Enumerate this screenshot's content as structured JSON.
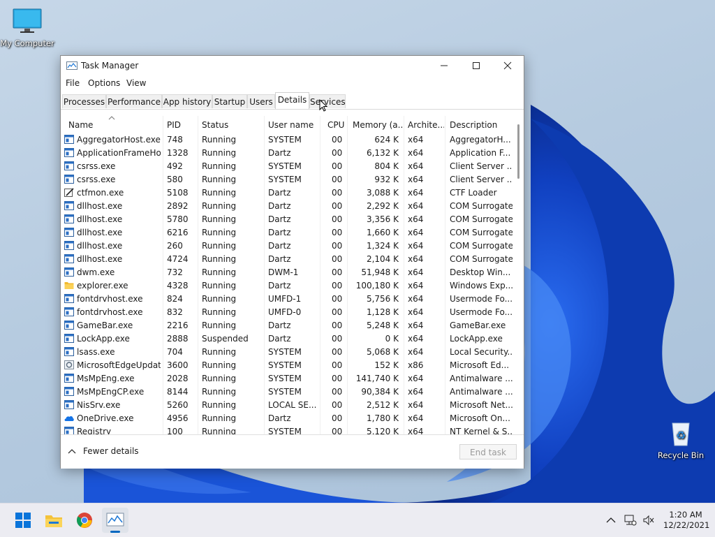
{
  "desktop": {
    "my_computer": "My Computer",
    "recycle_bin": "Recycle Bin"
  },
  "window": {
    "title": "Task Manager",
    "menu": [
      "File",
      "Options",
      "View"
    ],
    "tabs": [
      "Processes",
      "Performance",
      "App history",
      "Startup",
      "Users",
      "Details",
      "Services"
    ],
    "active_tab": "Details",
    "columns": [
      "Name",
      "PID",
      "Status",
      "User name",
      "CPU",
      "Memory (a...",
      "Archite...",
      "Description"
    ],
    "rows": [
      {
        "icon": "app-window-icon",
        "name": "AggregatorHost.exe",
        "pid": "748",
        "status": "Running",
        "user": "SYSTEM",
        "cpu": "00",
        "mem": "624 K",
        "arch": "x64",
        "desc": "AggregatorH..."
      },
      {
        "icon": "app-window-icon",
        "name": "ApplicationFrameHo...",
        "pid": "1328",
        "status": "Running",
        "user": "Dartz",
        "cpu": "00",
        "mem": "6,132 K",
        "arch": "x64",
        "desc": "Application F..."
      },
      {
        "icon": "app-window-icon",
        "name": "csrss.exe",
        "pid": "492",
        "status": "Running",
        "user": "SYSTEM",
        "cpu": "00",
        "mem": "804 K",
        "arch": "x64",
        "desc": "Client Server ..."
      },
      {
        "icon": "app-window-icon",
        "name": "csrss.exe",
        "pid": "580",
        "status": "Running",
        "user": "SYSTEM",
        "cpu": "00",
        "mem": "932 K",
        "arch": "x64",
        "desc": "Client Server ..."
      },
      {
        "icon": "pen-notepad-icon",
        "name": "ctfmon.exe",
        "pid": "5108",
        "status": "Running",
        "user": "Dartz",
        "cpu": "00",
        "mem": "3,088 K",
        "arch": "x64",
        "desc": "CTF Loader"
      },
      {
        "icon": "app-window-icon",
        "name": "dllhost.exe",
        "pid": "2892",
        "status": "Running",
        "user": "Dartz",
        "cpu": "00",
        "mem": "2,292 K",
        "arch": "x64",
        "desc": "COM Surrogate"
      },
      {
        "icon": "app-window-icon",
        "name": "dllhost.exe",
        "pid": "5780",
        "status": "Running",
        "user": "Dartz",
        "cpu": "00",
        "mem": "3,356 K",
        "arch": "x64",
        "desc": "COM Surrogate"
      },
      {
        "icon": "app-window-icon",
        "name": "dllhost.exe",
        "pid": "6216",
        "status": "Running",
        "user": "Dartz",
        "cpu": "00",
        "mem": "1,660 K",
        "arch": "x64",
        "desc": "COM Surrogate"
      },
      {
        "icon": "app-window-icon",
        "name": "dllhost.exe",
        "pid": "260",
        "status": "Running",
        "user": "Dartz",
        "cpu": "00",
        "mem": "1,324 K",
        "arch": "x64",
        "desc": "COM Surrogate"
      },
      {
        "icon": "app-window-icon",
        "name": "dllhost.exe",
        "pid": "4724",
        "status": "Running",
        "user": "Dartz",
        "cpu": "00",
        "mem": "2,104 K",
        "arch": "x64",
        "desc": "COM Surrogate"
      },
      {
        "icon": "app-window-icon",
        "name": "dwm.exe",
        "pid": "732",
        "status": "Running",
        "user": "DWM-1",
        "cpu": "00",
        "mem": "51,948 K",
        "arch": "x64",
        "desc": "Desktop Win..."
      },
      {
        "icon": "folder-icon",
        "name": "explorer.exe",
        "pid": "4328",
        "status": "Running",
        "user": "Dartz",
        "cpu": "00",
        "mem": "100,180 K",
        "arch": "x64",
        "desc": "Windows Exp..."
      },
      {
        "icon": "app-window-icon",
        "name": "fontdrvhost.exe",
        "pid": "824",
        "status": "Running",
        "user": "UMFD-1",
        "cpu": "00",
        "mem": "5,756 K",
        "arch": "x64",
        "desc": "Usermode Fo..."
      },
      {
        "icon": "app-window-icon",
        "name": "fontdrvhost.exe",
        "pid": "832",
        "status": "Running",
        "user": "UMFD-0",
        "cpu": "00",
        "mem": "1,128 K",
        "arch": "x64",
        "desc": "Usermode Fo..."
      },
      {
        "icon": "app-window-icon",
        "name": "GameBar.exe",
        "pid": "2216",
        "status": "Running",
        "user": "Dartz",
        "cpu": "00",
        "mem": "5,248 K",
        "arch": "x64",
        "desc": "GameBar.exe"
      },
      {
        "icon": "app-window-icon",
        "name": "LockApp.exe",
        "pid": "2888",
        "status": "Suspended",
        "user": "Dartz",
        "cpu": "00",
        "mem": "0 K",
        "arch": "x64",
        "desc": "LockApp.exe"
      },
      {
        "icon": "app-window-icon",
        "name": "lsass.exe",
        "pid": "704",
        "status": "Running",
        "user": "SYSTEM",
        "cpu": "00",
        "mem": "5,068 K",
        "arch": "x64",
        "desc": "Local Security..."
      },
      {
        "icon": "edge-update-icon",
        "name": "MicrosoftEdgeUpdat...",
        "pid": "3600",
        "status": "Running",
        "user": "SYSTEM",
        "cpu": "00",
        "mem": "152 K",
        "arch": "x86",
        "desc": "Microsoft Ed..."
      },
      {
        "icon": "app-window-icon",
        "name": "MsMpEng.exe",
        "pid": "2028",
        "status": "Running",
        "user": "SYSTEM",
        "cpu": "00",
        "mem": "141,740 K",
        "arch": "x64",
        "desc": "Antimalware ..."
      },
      {
        "icon": "app-window-icon",
        "name": "MsMpEngCP.exe",
        "pid": "8144",
        "status": "Running",
        "user": "SYSTEM",
        "cpu": "00",
        "mem": "90,384 K",
        "arch": "x64",
        "desc": "Antimalware ..."
      },
      {
        "icon": "app-window-icon",
        "name": "NisSrv.exe",
        "pid": "5260",
        "status": "Running",
        "user": "LOCAL SE...",
        "cpu": "00",
        "mem": "2,512 K",
        "arch": "x64",
        "desc": "Microsoft Net..."
      },
      {
        "icon": "onedrive-cloud-icon",
        "name": "OneDrive.exe",
        "pid": "4956",
        "status": "Running",
        "user": "Dartz",
        "cpu": "00",
        "mem": "1,780 K",
        "arch": "x64",
        "desc": "Microsoft On..."
      },
      {
        "icon": "app-window-icon",
        "name": "Registry",
        "pid": "100",
        "status": "Running",
        "user": "SYSTEM",
        "cpu": "00",
        "mem": "5,120 K",
        "arch": "x64",
        "desc": "NT Kernel & S..."
      }
    ],
    "footer": {
      "fewer_details": "Fewer details",
      "end_task": "End task"
    }
  },
  "taskbar": {
    "time": "1:20 AM",
    "date": "12/22/2021"
  },
  "colors": {
    "accent": "#0067c0",
    "taskbar": "#ececf2",
    "bloom": "#1446c8"
  }
}
